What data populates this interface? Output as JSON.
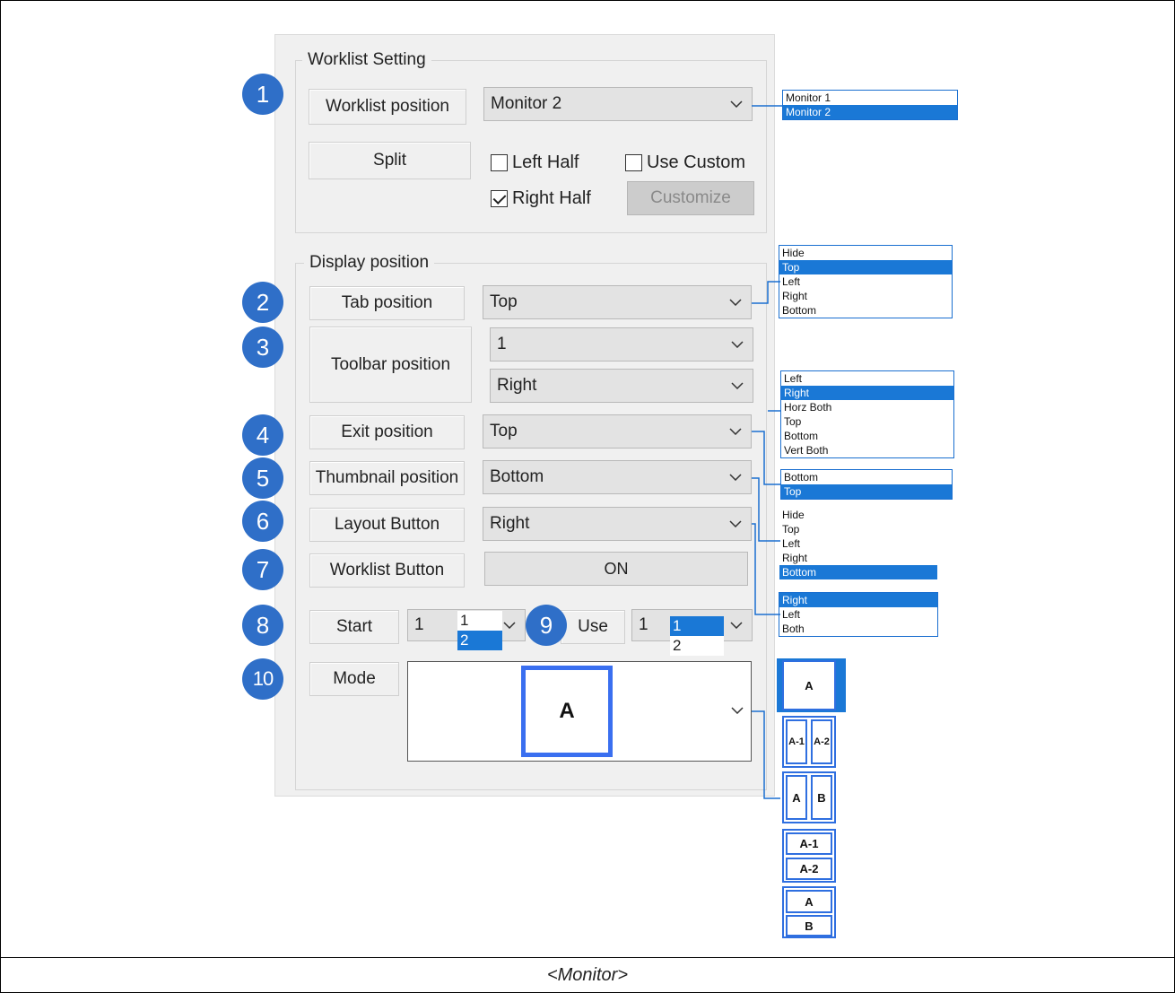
{
  "caption": "<Monitor>",
  "worklist_group": {
    "title": "Worklist Setting",
    "position_label": "Worklist position",
    "position_value": "Monitor 2",
    "position_options": [
      "Monitor 1",
      "Monitor 2"
    ],
    "position_selected": "Monitor 2",
    "split_label": "Split",
    "left_half": "Left Half",
    "left_half_checked": false,
    "right_half": "Right Half",
    "right_half_checked": true,
    "use_custom": "Use Custom",
    "use_custom_checked": false,
    "customize": "Customize"
  },
  "display_group": {
    "title": "Display position",
    "tab_label": "Tab position",
    "tab_value": "Top",
    "tab_options": [
      "Hide",
      "Top",
      "Left",
      "Right",
      "Bottom"
    ],
    "toolbar_label": "Toolbar position",
    "toolbar_count": "1",
    "toolbar_value": "Right",
    "toolbar_options": [
      "Left",
      "Right",
      "Horz Both",
      "Top",
      "Bottom",
      "Vert Both"
    ],
    "exit_label": "Exit position",
    "exit_value": "Top",
    "exit_options": [
      "Bottom",
      "Top"
    ],
    "thumb_label": "Thumbnail position",
    "thumb_value": "Bottom",
    "thumb_options": [
      "Hide",
      "Top",
      "Left",
      "Right",
      "Bottom"
    ],
    "layout_label": "Layout Button",
    "layout_value": "Right",
    "layout_options": [
      "Right",
      "Left",
      "Both"
    ],
    "worklist_btn_label": "Worklist Button",
    "worklist_btn_value": "ON",
    "start_label": "Start",
    "start_value": "1",
    "start_options": [
      "1",
      "2"
    ],
    "use_label": "Use",
    "use_value": "1",
    "use_options": [
      "1",
      "2"
    ],
    "mode_label": "Mode",
    "mode_value": "A",
    "mode_options": [
      "A",
      "A-1",
      "A-2",
      "A",
      "B",
      "A-1",
      "A-2",
      "A",
      "B"
    ]
  },
  "markers": [
    "1",
    "2",
    "3",
    "4",
    "5",
    "6",
    "7",
    "8",
    "9",
    "10"
  ],
  "colors": {
    "marker": "#2f6fc8",
    "selection": "#1a78d6",
    "mode_border": "#2f6fe0"
  }
}
